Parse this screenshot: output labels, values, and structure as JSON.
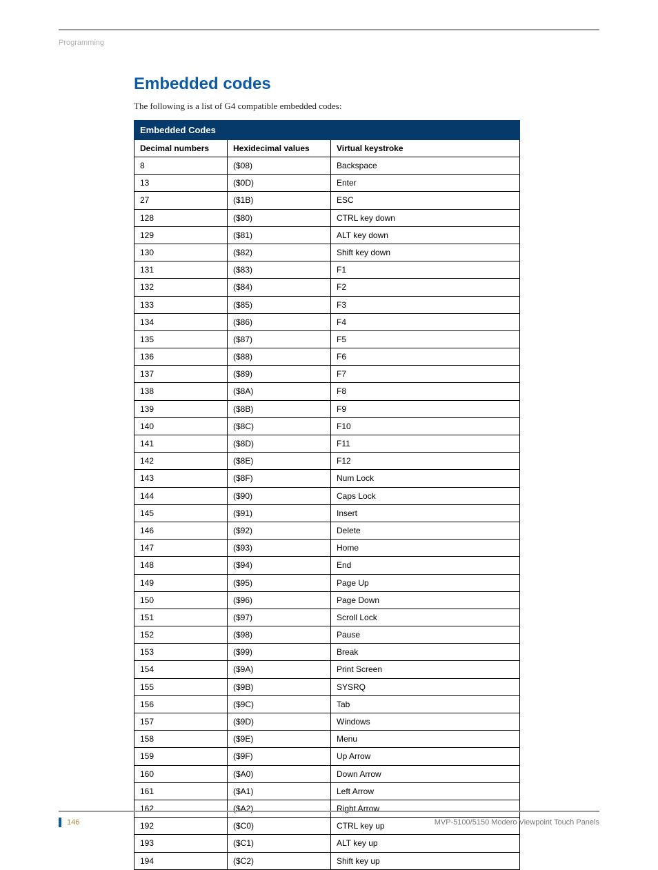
{
  "header": {
    "label": "Programming"
  },
  "section": {
    "title": "Embedded codes",
    "intro": "The following is a list of G4 compatible embedded codes:"
  },
  "table": {
    "title": "Embedded Codes",
    "columns": [
      "Decimal numbers",
      "Hexidecimal values",
      "Virtual keystroke"
    ],
    "rows": [
      {
        "dec": "8",
        "hex": "($08)",
        "vk": "Backspace"
      },
      {
        "dec": "13",
        "hex": "($0D)",
        "vk": "Enter"
      },
      {
        "dec": "27",
        "hex": "($1B)",
        "vk": "ESC"
      },
      {
        "dec": "128",
        "hex": "($80)",
        "vk": "CTRL key down"
      },
      {
        "dec": "129",
        "hex": "($81)",
        "vk": "ALT key down"
      },
      {
        "dec": "130",
        "hex": "($82)",
        "vk": "Shift key down"
      },
      {
        "dec": "131",
        "hex": "($83)",
        "vk": "F1"
      },
      {
        "dec": "132",
        "hex": "($84)",
        "vk": "F2"
      },
      {
        "dec": "133",
        "hex": "($85)",
        "vk": "F3"
      },
      {
        "dec": "134",
        "hex": "($86)",
        "vk": "F4"
      },
      {
        "dec": "135",
        "hex": "($87)",
        "vk": "F5"
      },
      {
        "dec": "136",
        "hex": "($88)",
        "vk": "F6"
      },
      {
        "dec": "137",
        "hex": "($89)",
        "vk": "F7"
      },
      {
        "dec": "138",
        "hex": "($8A)",
        "vk": "F8"
      },
      {
        "dec": "139",
        "hex": "($8B)",
        "vk": "F9"
      },
      {
        "dec": "140",
        "hex": "($8C)",
        "vk": "F10"
      },
      {
        "dec": "141",
        "hex": "($8D)",
        "vk": "F11"
      },
      {
        "dec": "142",
        "hex": "($8E)",
        "vk": "F12"
      },
      {
        "dec": "143",
        "hex": "($8F)",
        "vk": "Num Lock"
      },
      {
        "dec": "144",
        "hex": "($90)",
        "vk": "Caps Lock"
      },
      {
        "dec": "145",
        "hex": "($91)",
        "vk": "Insert"
      },
      {
        "dec": "146",
        "hex": "($92)",
        "vk": "Delete"
      },
      {
        "dec": "147",
        "hex": "($93)",
        "vk": "Home"
      },
      {
        "dec": "148",
        "hex": "($94)",
        "vk": "End"
      },
      {
        "dec": "149",
        "hex": "($95)",
        "vk": "Page Up"
      },
      {
        "dec": "150",
        "hex": "($96)",
        "vk": "Page Down"
      },
      {
        "dec": "151",
        "hex": "($97)",
        "vk": "Scroll Lock"
      },
      {
        "dec": "152",
        "hex": "($98)",
        "vk": "Pause"
      },
      {
        "dec": "153",
        "hex": "($99)",
        "vk": "Break"
      },
      {
        "dec": "154",
        "hex": "($9A)",
        "vk": "Print Screen"
      },
      {
        "dec": "155",
        "hex": "($9B)",
        "vk": "SYSRQ"
      },
      {
        "dec": "156",
        "hex": "($9C)",
        "vk": "Tab"
      },
      {
        "dec": "157",
        "hex": "($9D)",
        "vk": "Windows"
      },
      {
        "dec": "158",
        "hex": "($9E)",
        "vk": "Menu"
      },
      {
        "dec": "159",
        "hex": "($9F)",
        "vk": "Up Arrow"
      },
      {
        "dec": "160",
        "hex": "($A0)",
        "vk": "Down Arrow"
      },
      {
        "dec": "161",
        "hex": "($A1)",
        "vk": "Left Arrow"
      },
      {
        "dec": "162",
        "hex": "($A2)",
        "vk": "Right Arrow"
      },
      {
        "dec": "192",
        "hex": "($C0)",
        "vk": "CTRL key up"
      },
      {
        "dec": "193",
        "hex": "($C1)",
        "vk": "ALT key up"
      },
      {
        "dec": "194",
        "hex": "($C2)",
        "vk": "Shift key up"
      }
    ]
  },
  "footer": {
    "page": "146",
    "doc": "MVP-5100/5150 Modero Viewpoint  Touch Panels"
  }
}
